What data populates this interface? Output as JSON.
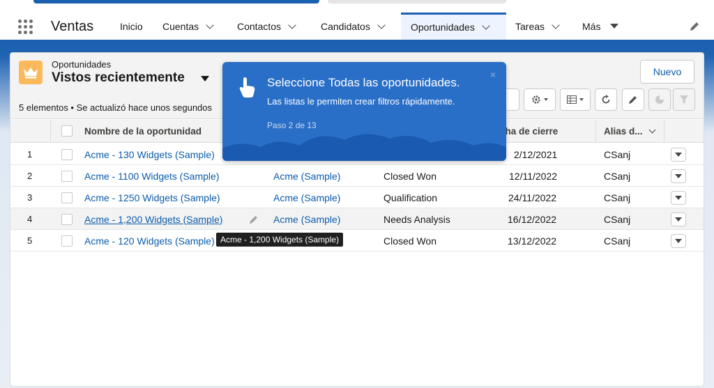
{
  "app": {
    "name": "Ventas"
  },
  "nav": {
    "items": [
      {
        "label": "Inicio",
        "has_menu": false
      },
      {
        "label": "Cuentas",
        "has_menu": true
      },
      {
        "label": "Contactos",
        "has_menu": true
      },
      {
        "label": "Candidatos",
        "has_menu": true
      },
      {
        "label": "Oportunidades",
        "has_menu": true,
        "active": true
      },
      {
        "label": "Tareas",
        "has_menu": true
      },
      {
        "label": "Más",
        "has_menu": true
      }
    ]
  },
  "list_view": {
    "object_label": "Oportunidades",
    "view_name": "Vistos recientemente",
    "status": "5 elementos • Se actualizó hace unos segundos",
    "new_button": "Nuevo",
    "columns": [
      "Nombre de la oportunidad",
      "cha de cierre",
      "Alias d..."
    ],
    "rows": [
      {
        "num": "1",
        "name": "Acme - 130 Widgets (Sample)",
        "account": "",
        "stage": "",
        "close_date": "2/12/2021",
        "alias": "CSanj"
      },
      {
        "num": "2",
        "name": "Acme - 1100 Widgets (Sample)",
        "account": "Acme (Sample)",
        "stage": "Closed Won",
        "close_date": "12/11/2022",
        "alias": "CSanj"
      },
      {
        "num": "3",
        "name": "Acme - 1250 Widgets (Sample)",
        "account": "Acme (Sample)",
        "stage": "Qualification",
        "close_date": "24/11/2022",
        "alias": "CSanj"
      },
      {
        "num": "4",
        "name": "Acme - 1,200 Widgets (Sample)",
        "account": "Acme (Sample)",
        "stage": "Needs Analysis",
        "close_date": "16/12/2022",
        "alias": "CSanj"
      },
      {
        "num": "5",
        "name": "Acme - 120 Widgets (Sample)",
        "account": "",
        "stage": "Closed Won",
        "close_date": "13/12/2022",
        "alias": "CSanj"
      }
    ]
  },
  "tooltip": {
    "text": "Acme - 1,200 Widgets (Sample)"
  },
  "walkthrough": {
    "title": "Seleccione Todas las oportunidades.",
    "body": "Las listas le permiten crear filtros rápidamente.",
    "step": "Paso 2 de 13",
    "close_symbol": "×"
  },
  "colors": {
    "brand": "#1b5fb0",
    "link": "#0b5cab",
    "popover": "#2a6fc7",
    "object_icon": "#fcb95b"
  },
  "icons": [
    "app-launcher-icon",
    "pencil-icon",
    "crown-icon",
    "gear-icon",
    "table-icon",
    "refresh-icon",
    "chart-icon",
    "filter-icon",
    "hand-pointer-icon"
  ]
}
